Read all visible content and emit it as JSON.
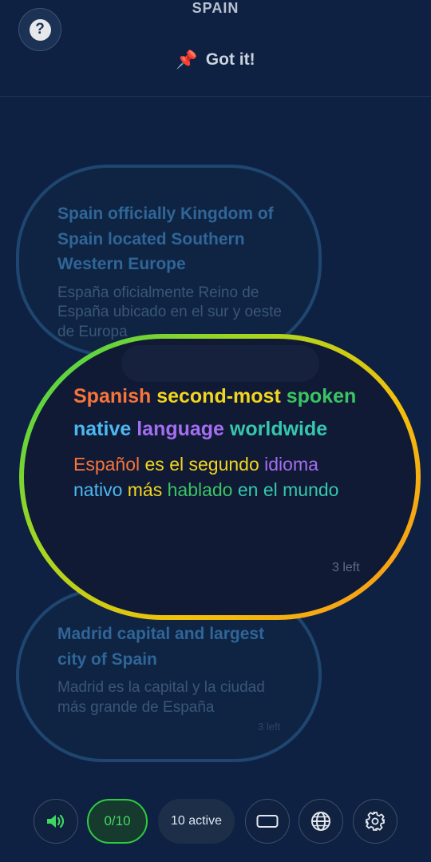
{
  "header": {
    "title": "SPAIN",
    "help_label": "?",
    "got_it_label": "Got it!",
    "got_it_icon": "pushpin-icon"
  },
  "cards": [
    {
      "en": "Spain officially Kingdom of Spain located Southern Western Europe",
      "es": "España oficialmente Reino de España ubicado en el sur y oeste de Europa",
      "left": ""
    },
    {
      "en_words": [
        "Spanish",
        "second-most",
        "spoken",
        "native",
        "language",
        "worldwide"
      ],
      "es_words": [
        "Español",
        "es el",
        "segundo",
        "idioma",
        "nativo",
        "más",
        "hablado",
        "en el",
        "mundo"
      ],
      "left": "3 left",
      "word_colors": {
        "orange": "#f7743a",
        "yellow": "#f2d51f",
        "green": "#3ac562",
        "blue": "#4cb8f0",
        "purple": "#a46ef0",
        "teal": "#35c7ad"
      }
    },
    {
      "en": "Madrid capital and largest city of Spain",
      "es": "Madrid es la capital y la ciudad más grande de España",
      "left": "3 left"
    }
  ],
  "toolbar": {
    "volume_icon": "volume-icon",
    "counter": "0/10",
    "active": "10 active",
    "card_icon": "card-icon",
    "globe_icon": "globe-icon",
    "settings_icon": "gear-icon"
  },
  "colors": {
    "background": "#0e2142",
    "accent_green": "#2ecc40"
  }
}
